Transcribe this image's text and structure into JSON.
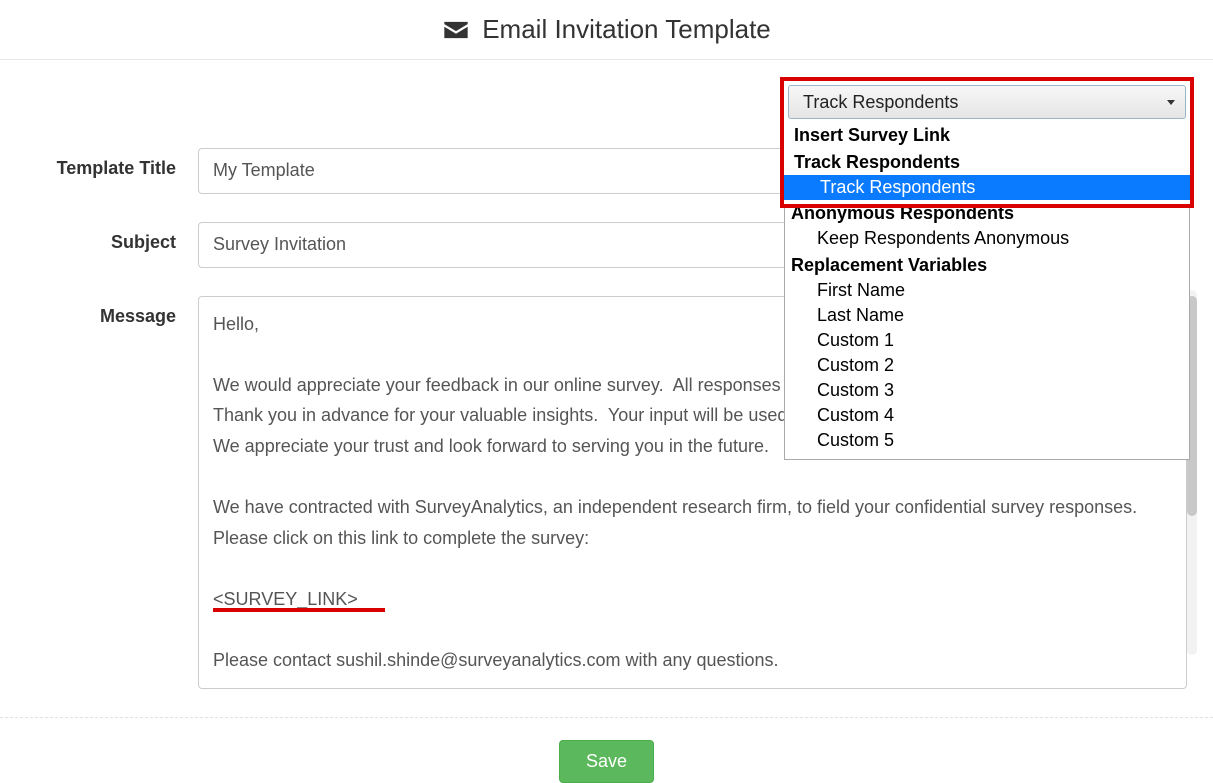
{
  "header": {
    "title": "Email Invitation Template"
  },
  "labels": {
    "template_title": "Template Title",
    "subject": "Subject",
    "message": "Message"
  },
  "fields": {
    "template_title_value": "My Template",
    "subject_value": "Survey Invitation",
    "message_value": "Hello,\n\nWe would appreciate your feedback in our online survey.  All responses will be kept strictly confidential and secure.  Thank you in advance for your valuable insights.  Your input will be used to ensure that we continue to meet your needs. We appreciate your trust and look forward to serving you in the future.\n\nWe have contracted with SurveyAnalytics, an independent research firm, to field your confidential survey responses.  Please click on this link to complete the survey:\n\n<SURVEY_LINK>\n\nPlease contact sushil.shinde@surveyanalytics.com with any questions."
  },
  "dropdown": {
    "selected_display": "Track Respondents",
    "groups": [
      {
        "header": "Insert Survey Link",
        "items": []
      },
      {
        "header": "Track Respondents",
        "items": [
          {
            "label": "Track Respondents",
            "selected": true
          }
        ]
      },
      {
        "header": "Anonymous Respondents",
        "items": [
          {
            "label": "Keep Respondents Anonymous",
            "selected": false
          }
        ]
      },
      {
        "header": "Replacement Variables",
        "items": [
          {
            "label": "First Name",
            "selected": false
          },
          {
            "label": "Last Name",
            "selected": false
          },
          {
            "label": "Custom 1",
            "selected": false
          },
          {
            "label": "Custom 2",
            "selected": false
          },
          {
            "label": "Custom 3",
            "selected": false
          },
          {
            "label": "Custom 4",
            "selected": false
          },
          {
            "label": "Custom 5",
            "selected": false
          }
        ]
      }
    ]
  },
  "footer": {
    "save_label": "Save"
  }
}
